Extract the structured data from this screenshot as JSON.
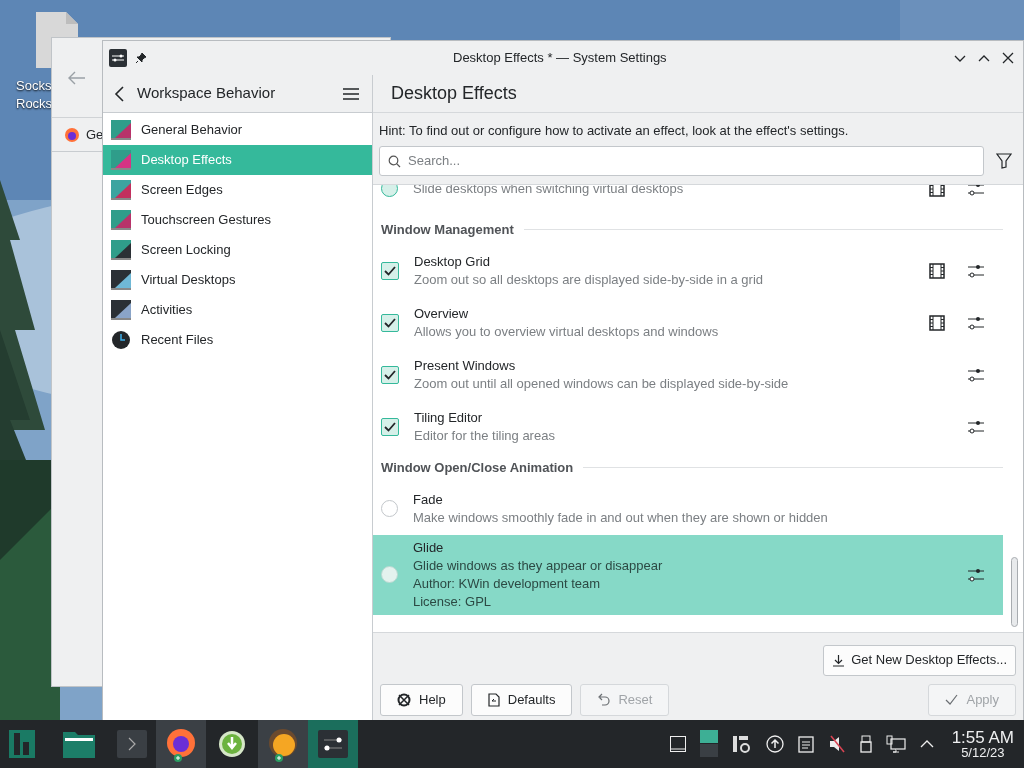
{
  "desktop_icon": {
    "label_lines": [
      "Socks",
      "Rocks"
    ]
  },
  "background_window": {
    "tab_label": "Ge"
  },
  "window": {
    "title": "Desktop Effects * — System Settings"
  },
  "sidebar": {
    "title": "Workspace Behavior",
    "items": [
      {
        "label": "General Behavior",
        "selected": false
      },
      {
        "label": "Desktop Effects",
        "selected": true
      },
      {
        "label": "Screen Edges",
        "selected": false
      },
      {
        "label": "Touchscreen Gestures",
        "selected": false
      },
      {
        "label": "Screen Locking",
        "selected": false
      },
      {
        "label": "Virtual Desktops",
        "selected": false
      },
      {
        "label": "Activities",
        "selected": false
      },
      {
        "label": "Recent Files",
        "selected": false
      }
    ]
  },
  "page": {
    "title": "Desktop Effects",
    "hint": "Hint: To find out or configure how to activate an effect, look at the effect's settings.",
    "search": {
      "placeholder": "Search..."
    }
  },
  "effects": [
    {
      "kind": "radio",
      "checked": true,
      "selected": false,
      "description": "Slide desktops when switching virtual desktops",
      "video": true,
      "configurable": true
    },
    {
      "kind": "header",
      "title": "Window Management"
    },
    {
      "kind": "checkbox",
      "checked": true,
      "selected": false,
      "title": "Desktop Grid",
      "description": "Zoom out so all desktops are displayed side-by-side in a grid",
      "video": true,
      "configurable": true
    },
    {
      "kind": "checkbox",
      "checked": true,
      "selected": false,
      "title": "Overview",
      "description": "Allows you to overview virtual desktops and windows",
      "video": true,
      "configurable": true
    },
    {
      "kind": "checkbox",
      "checked": true,
      "selected": false,
      "title": "Present Windows",
      "description": "Zoom out until all opened windows can be displayed side-by-side",
      "video": false,
      "configurable": true
    },
    {
      "kind": "checkbox",
      "checked": true,
      "selected": false,
      "title": "Tiling Editor",
      "description": "Editor for the tiling areas",
      "video": false,
      "configurable": true
    },
    {
      "kind": "header",
      "title": "Window Open/Close Animation"
    },
    {
      "kind": "radio",
      "checked": false,
      "selected": false,
      "title": "Fade",
      "description": "Make windows smoothly fade in and out when they are shown or hidden",
      "video": false,
      "configurable": false
    },
    {
      "kind": "radio",
      "checked": false,
      "selected": true,
      "title": "Glide",
      "description": "Glide windows as they appear or disappear",
      "details": [
        "Author: KWin development team",
        "License: GPL"
      ],
      "video": false,
      "configurable": true
    }
  ],
  "get_new_button": "Get New Desktop Effects...",
  "buttons": [
    {
      "label": "Help",
      "kind": "help",
      "disabled": false
    },
    {
      "label": "Defaults",
      "kind": "defaults",
      "disabled": false
    },
    {
      "label": "Reset",
      "kind": "reset",
      "disabled": true
    }
  ],
  "apply_button": {
    "label": "Apply",
    "disabled": true
  },
  "taskbar": {
    "time": "1:55 AM",
    "date": "5/12/23"
  }
}
